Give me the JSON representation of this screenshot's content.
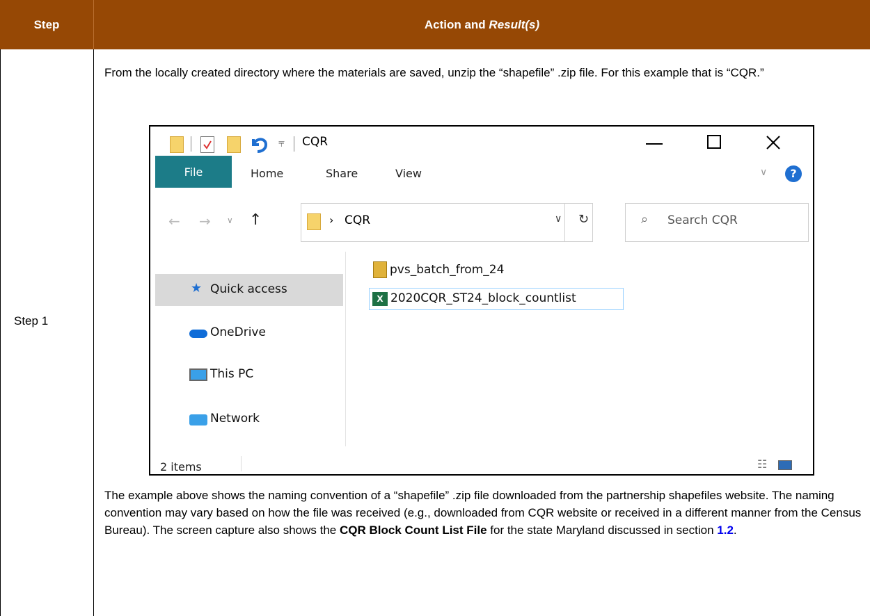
{
  "header": {
    "step": "Step",
    "action": "Action and ",
    "result": "Result(s)"
  },
  "row": {
    "step": "Step 1",
    "intro": "From the locally created directory where the materials are saved, unzip the “shapefile” .zip file. For this example that is “CQR.”",
    "desc_part1": "The example above shows the naming convention of a “shapefile” .zip file downloaded from the partnership shapefiles website. The naming convention may vary based on how the file was received (e.g., downloaded from CQR website or received in a different manner from the Census Bureau). The screen capture also shows the ",
    "desc_bold": "CQR Block Count List File",
    "desc_part2": " for the state Maryland discussed in section ",
    "desc_link": "1.2",
    "desc_end": "."
  },
  "explorer": {
    "title": "CQR",
    "tabs": [
      "File",
      "Home",
      "Share",
      "View"
    ],
    "address": "CQR",
    "search_placeholder": "Search CQR",
    "nav": [
      "Quick access",
      "OneDrive",
      "This PC",
      "Network"
    ],
    "files": [
      "pvs_batch_from_24",
      "2020CQR_ST24_block_countlist"
    ],
    "status": "2 items",
    "colors": {
      "ribbon_file": "#1c7c88",
      "header": "#964805",
      "selection": "#cce8ff"
    }
  }
}
